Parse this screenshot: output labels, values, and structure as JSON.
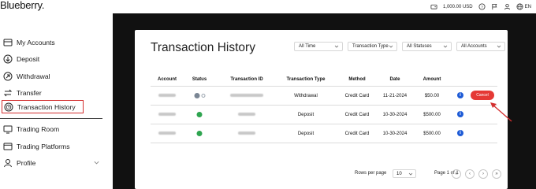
{
  "topbar": {
    "brand": "Blueberry.",
    "balance": "1,000.00 USD",
    "language": "EN"
  },
  "sidebar": {
    "items": [
      {
        "label": "My Accounts",
        "icon": "account-icon"
      },
      {
        "label": "Deposit",
        "icon": "deposit-icon"
      },
      {
        "label": "Withdrawal",
        "icon": "withdrawal-icon"
      },
      {
        "label": "Transfer",
        "icon": "transfer-icon"
      },
      {
        "label": "Transaction History",
        "icon": "history-icon",
        "active": true
      },
      {
        "label": "Trading Room",
        "icon": "trading-room-icon"
      },
      {
        "label": "Trading Platforms",
        "icon": "platforms-icon"
      },
      {
        "label": "Profile",
        "icon": "profile-icon"
      }
    ]
  },
  "page": {
    "title": "Transaction History",
    "filters": {
      "time": "All Time",
      "type": "Transaction Type",
      "status": "All Statuses",
      "accounts": "All Accounts"
    },
    "columns": [
      "Account",
      "Status",
      "Transaction ID",
      "Transaction Type",
      "Method",
      "Date",
      "Amount"
    ],
    "rows": [
      {
        "type": "Withdrawal",
        "method": "Credit Card",
        "date": "11-21-2024",
        "amount": "$50.00",
        "status": "pending",
        "action": "Cancel"
      },
      {
        "type": "Deposit",
        "method": "Credit Card",
        "date": "10-30-2024",
        "amount": "$500.00",
        "status": "approved"
      },
      {
        "type": "Deposit",
        "method": "Credit Card",
        "date": "10-30-2024",
        "amount": "$500.00",
        "status": "approved"
      }
    ],
    "pagination": {
      "rows_per_page_label": "Rows per page",
      "rows_per_page": "10",
      "page_info": "Page 1 of 1"
    }
  },
  "colors": {
    "accent_red": "#e53935",
    "info_blue": "#1e5bd6",
    "approved_green": "#2ea44f",
    "main_bg": "#111111"
  }
}
